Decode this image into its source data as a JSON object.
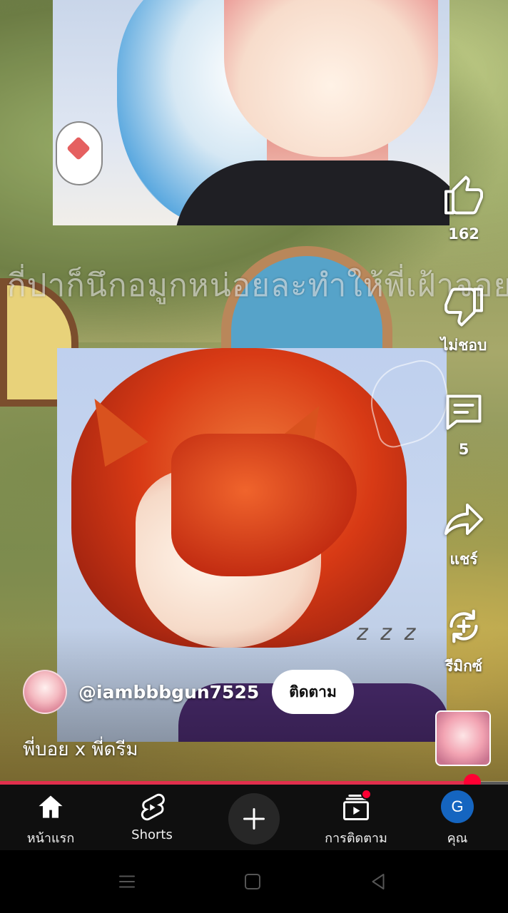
{
  "video": {
    "overlay_text": "กี่ปาก็นึกอมูกหน่อยละทำให้พี่เฝ้าจอย",
    "zzz_text": "z z z"
  },
  "actions": {
    "like": {
      "icon": "thumbs-up-icon",
      "label": "162"
    },
    "dislike": {
      "icon": "thumbs-down-icon",
      "label": "ไม่ชอบ"
    },
    "comments": {
      "icon": "comment-icon",
      "label": "5"
    },
    "share": {
      "icon": "share-icon",
      "label": "แชร์"
    },
    "remix": {
      "icon": "remix-icon",
      "label": "รีมิกซ์"
    }
  },
  "channel": {
    "handle": "@iambbbgun7525",
    "subscribe_label": "ติดตาม"
  },
  "video_title": "พี่บอย x พี่ดรีม",
  "progress": {
    "fraction": 0.93,
    "color": "#e12f4d"
  },
  "bottom_nav": {
    "home": {
      "icon": "home-icon",
      "label": "หน้าแรก"
    },
    "shorts": {
      "icon": "shorts-icon",
      "label": "Shorts"
    },
    "create": {
      "icon": "plus-icon"
    },
    "subscriptions": {
      "icon": "subscriptions-icon",
      "label": "การติดตาม"
    },
    "you": {
      "icon": "account-avatar",
      "initial": "G",
      "label": "คุณ",
      "color": "#1565c0"
    }
  },
  "system_nav": {
    "recents": "recents-icon",
    "home": "square-home-icon",
    "back": "back-triangle-icon"
  }
}
